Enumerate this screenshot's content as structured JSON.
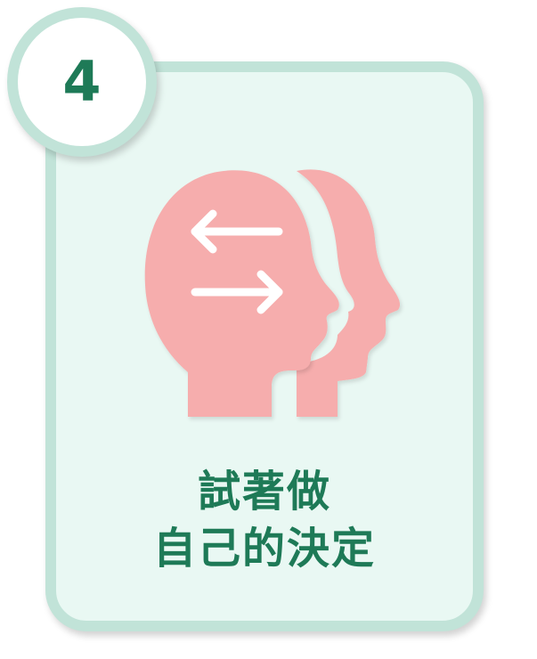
{
  "badge": {
    "number": "4"
  },
  "caption": {
    "line1": "試著做",
    "line2": "自己的決定"
  },
  "illustration": {
    "icon": "two-heads-exchange-arrows-icon",
    "colors": {
      "head": "#f6adad",
      "arrows": "#ffffff"
    }
  },
  "colors": {
    "card_background": "#e9f8f3",
    "card_border": "#c1e3d8",
    "text": "#1e7a57"
  }
}
